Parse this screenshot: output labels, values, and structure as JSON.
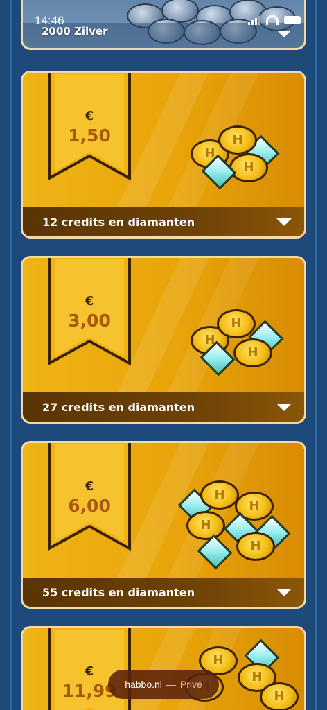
{
  "status_bar": {
    "time": "14:46"
  },
  "top_offer": {
    "label": "2000 Zilver"
  },
  "offers": [
    {
      "currency": "€",
      "price": "1,50",
      "label": "12 credits en diamanten"
    },
    {
      "currency": "€",
      "price": "3,00",
      "label": "27 credits en diamanten"
    },
    {
      "currency": "€",
      "price": "6,00",
      "label": "55 credits en diamanten"
    },
    {
      "currency": "€",
      "price": "11,99",
      "label": ""
    }
  ],
  "browser": {
    "host": "habbo.nl",
    "separator": "—",
    "mode": "Privé"
  },
  "icons": [
    "signal-icon",
    "wifi-icon",
    "battery-icon",
    "chevron-down-icon",
    "coin-pile-icon"
  ],
  "colors": {
    "background": "#1d4a7a",
    "card": "#e8a40a",
    "card_border": "#f3d9a8",
    "footer": "#5a3404",
    "price": "#a85a0c"
  }
}
